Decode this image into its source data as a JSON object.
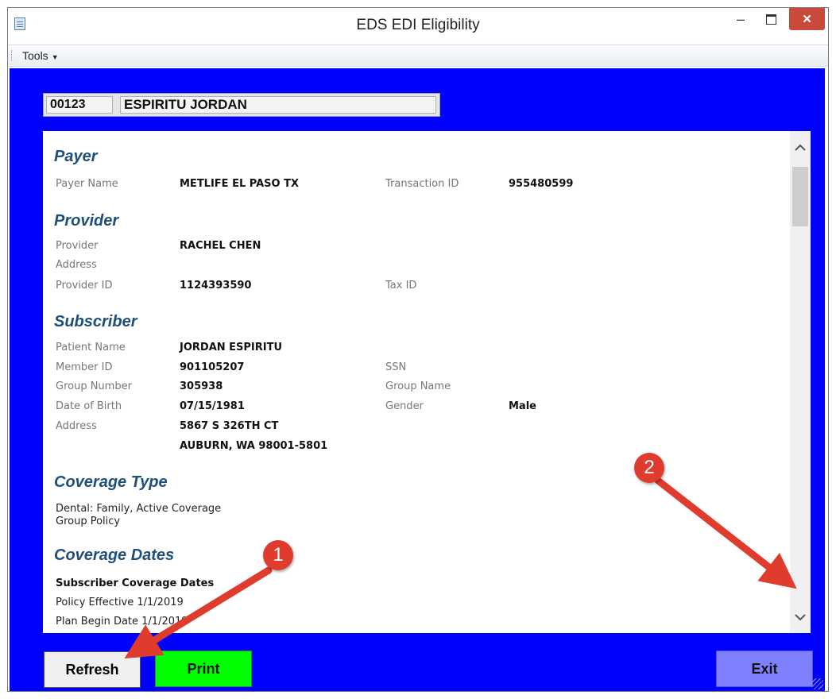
{
  "window": {
    "title": "EDS EDI Eligibility",
    "close_glyph": "✕",
    "minimize_glyph": "–"
  },
  "menu": {
    "tools": "Tools"
  },
  "header": {
    "account": "00123",
    "patient_name": "ESPIRITU JORDAN"
  },
  "payer": {
    "heading": "Payer",
    "name_label": "Payer Name",
    "name_value": "METLIFE EL PASO TX",
    "txn_label": "Transaction ID",
    "txn_value": "955480599"
  },
  "provider": {
    "heading": "Provider",
    "provider_label": "Provider",
    "provider_value": "RACHEL CHEN",
    "address_label": "Address",
    "id_label": "Provider ID",
    "id_value": "1124393590",
    "tax_label": "Tax ID"
  },
  "subscriber": {
    "heading": "Subscriber",
    "patient_label": "Patient Name",
    "patient_value": "JORDAN ESPIRITU",
    "member_label": "Member ID",
    "member_value": "901105207",
    "ssn_label": "SSN",
    "group_label": "Group Number",
    "group_value": "305938",
    "group_name_label": "Group Name",
    "dob_label": "Date of Birth",
    "dob_value": "07/15/1981",
    "gender_label": "Gender",
    "gender_value": "Male",
    "address_label": "Address",
    "address_line1": "5867 S 326TH CT",
    "address_line2": "AUBURN, WA 98001-5801"
  },
  "coverage_type": {
    "heading": "Coverage Type",
    "line1": "Dental: Family, Active Coverage",
    "line2": "Group Policy"
  },
  "coverage_dates": {
    "heading": "Coverage Dates",
    "sub_heading": "Subscriber Coverage Dates",
    "policy_effective": "Policy Effective 1/1/2019",
    "plan_begin": "Plan Begin Date 1/1/2019"
  },
  "buttons": {
    "refresh": "Refresh",
    "print": "Print",
    "exit": "Exit"
  },
  "annotations": {
    "marker1": "1",
    "marker2": "2"
  },
  "colors": {
    "background": "#0000ff",
    "print_button": "#00ff00",
    "exit_button": "#8080ff",
    "section_heading": "#1f4e79",
    "marker": "#e03c2e"
  }
}
